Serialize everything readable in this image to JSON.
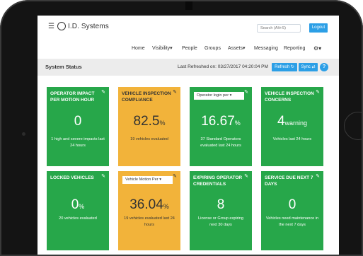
{
  "app": {
    "logo_text": "I.D. Systems",
    "search_placeholder": "Search (Alt+S)",
    "logout_label": "Logout"
  },
  "nav": {
    "items": [
      "Home",
      "Visibility▾",
      "People",
      "Groups",
      "Assets▾",
      "Messaging",
      "Reporting"
    ],
    "gear_label": "⚙▾"
  },
  "status_bar": {
    "title": "System Status",
    "last_refreshed": "Last Refreshed on: 03/27/2017 04:20:04 PM",
    "refresh_label": "Refresh ↻",
    "sync_label": "Sync ⇄",
    "help_label": "?"
  },
  "tiles": [
    {
      "title": "OPERATOR IMPACT PER MOTION HOUR",
      "value": "0",
      "unit": "",
      "desc": "1 high and severe impacts last 24 hours",
      "color": "#27a74a"
    },
    {
      "title": "VEHICLE INSPECTION COMPLIANCE",
      "value": "82.5",
      "unit": "%",
      "desc": "19 vehicles evaluated",
      "color": "#f2b33a"
    },
    {
      "dropdown": "Operator login per ▾",
      "value": "16.67",
      "unit": "%",
      "desc": "37 Standard Operators evaluated last 24 hours",
      "color": "#27a74a"
    },
    {
      "title": "VEHICLE INSPECTION CONCERNS",
      "value": "4",
      "unit": "warning",
      "desc": "Vehicles last 24 hours",
      "color": "#27a74a"
    },
    {
      "title": "LOCKED VEHICLES",
      "value": "0",
      "unit": "%",
      "desc": "20 vehicles evaluated",
      "color": "#27a74a"
    },
    {
      "dropdown": "Vehicle Motion Per ▾",
      "value": "36.04",
      "unit": "%",
      "desc": "19 vehicles evaluated last 24 hours",
      "color": "#f2b33a"
    },
    {
      "title": "EXPIRING OPERATOR CREDENTIALS",
      "value": "8",
      "unit": "",
      "desc": "License or Group expiring next 30 days",
      "color": "#27a74a"
    },
    {
      "title": "SERVICE DUE NEXT 7 DAYS",
      "value": "0",
      "unit": "",
      "desc": "Vehicles need maintenance in the next 7 days",
      "color": "#27a74a"
    }
  ]
}
